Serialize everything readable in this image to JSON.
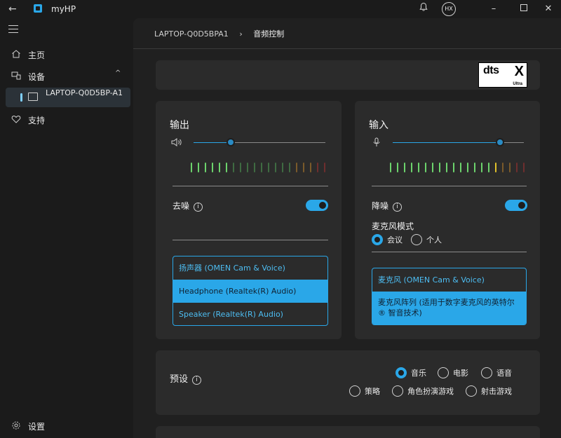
{
  "window": {
    "app_title": "myHP",
    "avatar_initials": "HX"
  },
  "sidebar": {
    "items": [
      {
        "label": "主页"
      },
      {
        "label": "设备"
      },
      {
        "label": "LAPTOP-Q0D5BP-A1"
      },
      {
        "label": "支持"
      }
    ],
    "settings_label": "设置"
  },
  "breadcrumb": {
    "device": "LAPTOP-Q0D5BPA1",
    "page": "音频控制"
  },
  "logo": {
    "text": "dts",
    "mark": "X",
    "sub": "Ultra"
  },
  "output": {
    "title": "输出",
    "volume_percent": 28,
    "noise_label": "去噪",
    "noise_on": true,
    "devices": [
      {
        "label": "扬声器 (OMEN Cam & Voice)",
        "selected": false
      },
      {
        "label": "Headphone (Realtek(R) Audio)",
        "selected": true
      },
      {
        "label": "Speaker (Realtek(R) Audio)",
        "selected": false
      }
    ]
  },
  "input": {
    "title": "输入",
    "volume_percent": 82,
    "noise_label": "降噪",
    "noise_on": true,
    "mic_mode_label": "麦克风模式",
    "mic_modes": [
      {
        "label": "会议",
        "selected": true
      },
      {
        "label": "个人",
        "selected": false
      }
    ],
    "devices": [
      {
        "label": "麦克风 (OMEN Cam & Voice)",
        "selected": false
      },
      {
        "label": "麦克风阵列 (适用于数字麦克风的英特尔® 智音技术)",
        "selected": true
      }
    ]
  },
  "presets": {
    "label": "预设",
    "options": [
      {
        "label": "音乐",
        "selected": true
      },
      {
        "label": "电影",
        "selected": false
      },
      {
        "label": "语音",
        "selected": false
      },
      {
        "label": "策略",
        "selected": false
      },
      {
        "label": "角色扮演游戏",
        "selected": false
      },
      {
        "label": "射击游戏",
        "selected": false
      }
    ]
  },
  "colors": {
    "accent": "#2aa7e8",
    "meter_green_active": "#6cd36c",
    "meter_green_dim": "#3f6b42",
    "meter_yellow": "#e0c12a",
    "meter_orange_dim": "#7a5a2a",
    "meter_red_dim": "#6e2e2e"
  }
}
